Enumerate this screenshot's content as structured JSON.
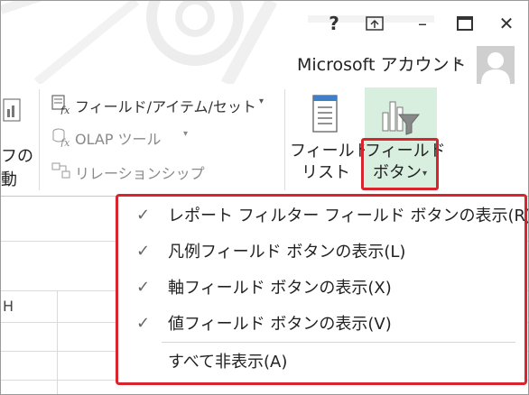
{
  "window": {
    "help_label": "?",
    "minimize_label": "–",
    "close_label": "✕",
    "account_name": "Microsoft アカウント",
    "account_caret": "▾"
  },
  "ribbon": {
    "left_fragment_line1": "フの",
    "left_fragment_line2": "動",
    "field_items_sets": "フィールド/アイテム/セット",
    "field_items_sets_caret": "▾",
    "olap_tools": "OLAP ツール",
    "olap_tools_caret": "▾",
    "relationships": "リレーションシップ",
    "field_list_line1": "フィールド",
    "field_list_line2": "リスト",
    "field_buttons_line1": "フィールド",
    "field_buttons_line2": "ボタン",
    "field_buttons_caret": "▾"
  },
  "grid": {
    "col_fragment": "H"
  },
  "menu": {
    "items": [
      {
        "label": "レポート フィルター フィールド ボタンの表示(R)",
        "checked": true
      },
      {
        "label": "凡例フィールド ボタンの表示(L)",
        "checked": true
      },
      {
        "label": "軸フィールド ボタンの表示(X)",
        "checked": true
      },
      {
        "label": "値フィールド ボタンの表示(V)",
        "checked": true
      },
      {
        "label": "すべて非表示(A)",
        "checked": false
      }
    ],
    "check_glyph": "✓"
  },
  "colors": {
    "highlight_border": "#d9232d",
    "pivot_button_bg": "#d8efe0"
  }
}
